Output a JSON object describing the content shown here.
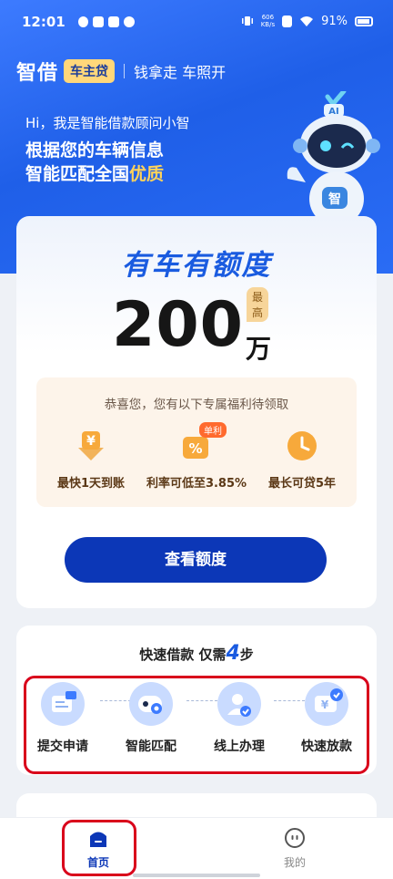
{
  "status_bar": {
    "time": "12:01",
    "speed_top": "606",
    "speed_bottom": "KB/s",
    "battery": "91%"
  },
  "header": {
    "logo": "智借",
    "badge": "车主贷",
    "slogan": "钱拿走 车照开"
  },
  "hero": {
    "greeting": "Hi，我是智能借款顾问小智",
    "headline_line1": "根据您的车辆信息",
    "headline_line2_prefix": "智能匹配全国",
    "headline_line2_highlight": "优质",
    "robot_badge": "AI",
    "robot_chest": "智"
  },
  "main_card": {
    "title": "有车有额度",
    "max_tag": "最高",
    "amount": "200",
    "unit": "万",
    "benefit_title": "恭喜您，您有以下专属福利待领取",
    "benefits": [
      {
        "icon": "yuan-coin-icon",
        "glyph": "¥",
        "label": "最快1天到账"
      },
      {
        "icon": "percent-ticket-icon",
        "glyph": "%",
        "tag": "单利",
        "label": "利率可低至3.85%"
      },
      {
        "icon": "clock-icon",
        "label": "最长可贷5年"
      }
    ],
    "cta": "查看额度"
  },
  "steps": {
    "title_prefix": "快速借款 仅需",
    "title_num": "4",
    "title_suffix": "步",
    "items": [
      {
        "icon": "chat-message-icon",
        "label": "提交申请"
      },
      {
        "icon": "robot-match-icon",
        "label": "智能匹配"
      },
      {
        "icon": "user-check-icon",
        "label": "线上办理"
      },
      {
        "icon": "yuan-check-icon",
        "glyph": "¥",
        "label": "快速放款"
      }
    ]
  },
  "nav": {
    "items": [
      {
        "label": "首页",
        "active": true
      },
      {
        "label": "我的",
        "active": false
      }
    ]
  },
  "colors": {
    "primary": "#0c37b7",
    "accent_blue": "#1a5be0",
    "highlight": "#ffd35a",
    "annotation_red": "#d9001b"
  }
}
